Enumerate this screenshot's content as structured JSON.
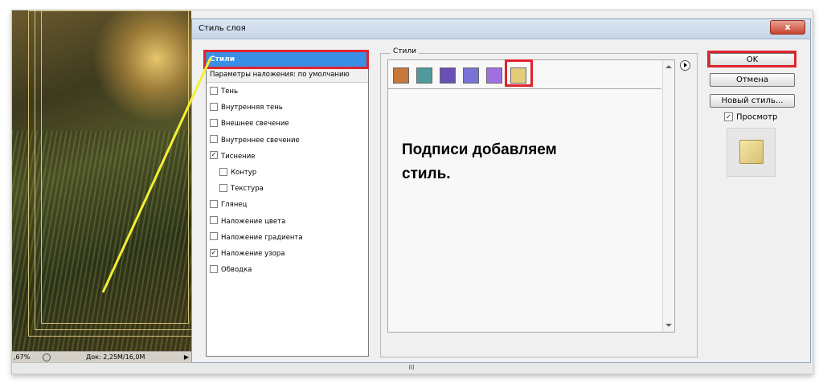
{
  "status_bar": {
    "zoom": ",67%",
    "doc": "Док: 2,25M/16,0M"
  },
  "dialog": {
    "title": "Стиль слоя",
    "close_label": "x",
    "left_panel": {
      "header": "Стили",
      "blend_options": "Параметры наложения: по умолчанию",
      "effects": [
        {
          "label": "Тень",
          "checked": false,
          "sub": false
        },
        {
          "label": "Внутренняя тень",
          "checked": false,
          "sub": false
        },
        {
          "label": "Внешнее свечение",
          "checked": false,
          "sub": false
        },
        {
          "label": "Внутреннее свечение",
          "checked": false,
          "sub": false
        },
        {
          "label": "Тиснение",
          "checked": true,
          "sub": false
        },
        {
          "label": "Контур",
          "checked": false,
          "sub": true
        },
        {
          "label": "Текстура",
          "checked": false,
          "sub": true
        },
        {
          "label": "Глянец",
          "checked": false,
          "sub": false
        },
        {
          "label": "Наложение цвета",
          "checked": false,
          "sub": false
        },
        {
          "label": "Наложение градиента",
          "checked": false,
          "sub": false
        },
        {
          "label": "Наложение узора",
          "checked": true,
          "sub": false
        },
        {
          "label": "Обводка",
          "checked": false,
          "sub": false
        }
      ]
    },
    "styles_group": {
      "label": "Стили",
      "swatches": [
        {
          "name": "orange-texture",
          "color": "#c8783a"
        },
        {
          "name": "teal-texture",
          "color": "#4f9a9c"
        },
        {
          "name": "purple-sparkle",
          "color": "#6a4fb5"
        },
        {
          "name": "violet",
          "color": "#7a72d8"
        },
        {
          "name": "lilac-sparkle",
          "color": "#a070e0"
        },
        {
          "name": "gold",
          "color": "#e4cc78"
        }
      ],
      "caption_line1": "Подписи добавляем",
      "caption_line2": "стиль."
    },
    "buttons": {
      "ok": "OK",
      "cancel": "Отмена",
      "new_style": "Новый стиль...",
      "preview_label": "Просмотр",
      "preview_checked": true
    }
  },
  "bottom_grip": "III",
  "colors": {
    "highlight": "#3a8ee6",
    "annotation_red": "#e0242c",
    "annotation_yellow": "#f4f032"
  }
}
